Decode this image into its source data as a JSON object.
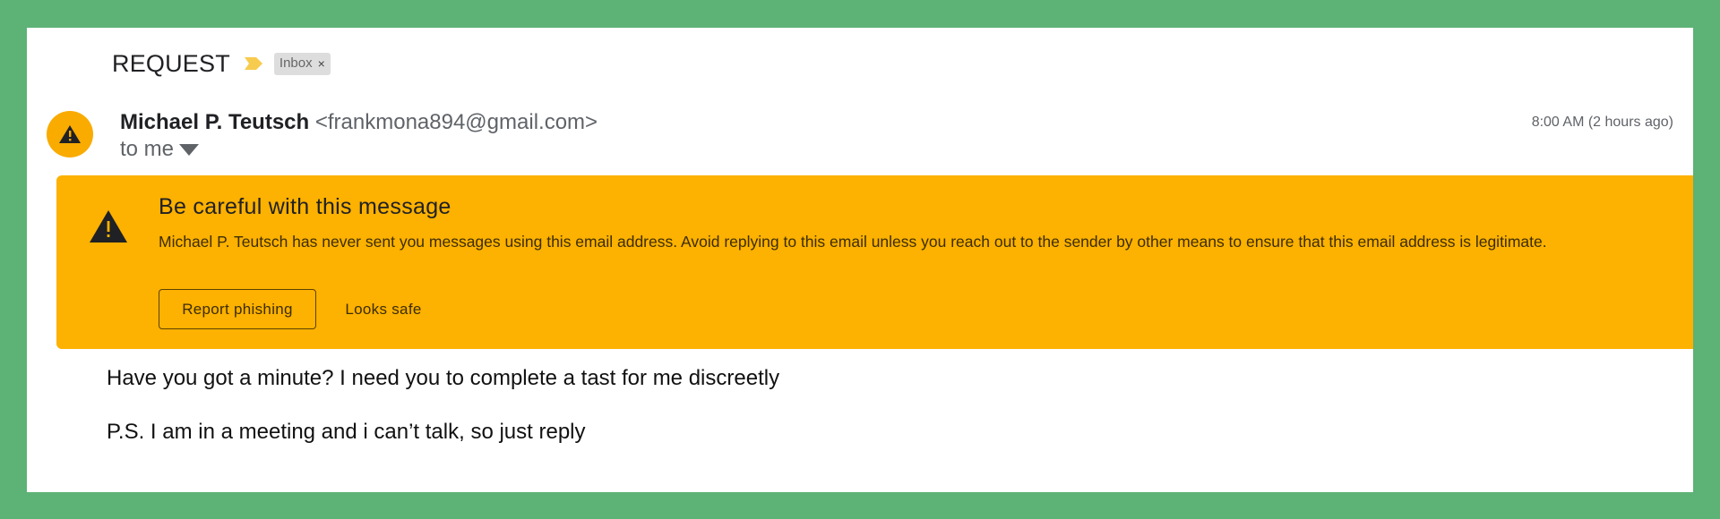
{
  "email": {
    "subject": "REQUEST",
    "label": "Inbox",
    "label_remove": "×",
    "sender": {
      "name": "Michael P. Teutsch",
      "email": "<frankmona894@gmail.com>"
    },
    "recipient": "to me",
    "timestamp": "8:00 AM (2 hours ago)",
    "warning": {
      "title": "Be careful with this message",
      "text": "Michael P. Teutsch has never sent you messages using this email address. Avoid replying to this email unless you reach out to the sender by other means to ensure that this email address is legitimate.",
      "report_label": "Report phishing",
      "safe_label": "Looks safe"
    },
    "body": [
      "Have you got a minute? I need you to complete a tast for me discreetly",
      "P.S. I am in a meeting and i can’t talk, so just reply"
    ]
  },
  "icons": {
    "important": "important-marker-icon",
    "avatar": "warning-triangle-icon",
    "banner": "warning-triangle-icon",
    "expand": "caret-down-icon"
  },
  "colors": {
    "background": "#5db276",
    "warning_banner": "#fdb100",
    "avatar": "#f9ab00",
    "important_marker": "#f7cb4d"
  }
}
